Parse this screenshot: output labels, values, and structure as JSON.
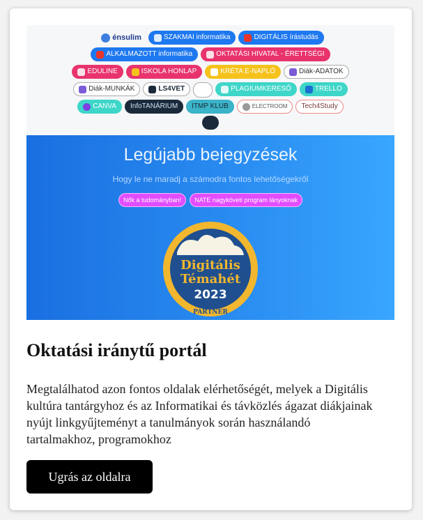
{
  "links_panel": {
    "logo_text": "énsulim",
    "row1": [
      "SZAKMAI informatika",
      "DIGITÁLIS írástudás"
    ],
    "row2": [
      "ALKALMAZOTT informatika",
      "OKTATÁSI HIVATAL - ÉRETTSÉGI"
    ],
    "row3": [
      "EDULINE",
      "ISKOLA HONLAP",
      "KRÉTA E-NAPLÓ",
      "Diák-ADATOK"
    ],
    "row4": [
      "Diák-MUNKÁK",
      "LS4VET",
      "",
      "PLAGIUMKERESŐ",
      "TRELLO"
    ],
    "row5": [
      "CANVA",
      "InfoTANÁRIUM",
      "ITMP KLUB",
      "ELECTROOM",
      "Tech4Study"
    ],
    "colors": {
      "blue": "#1e78f0",
      "red": "#e8352b",
      "pink": "#e8336c",
      "yellow": "#f5c21b",
      "teal": "#3ed6c8",
      "dark": "#1b2a3a"
    }
  },
  "hero": {
    "title": "Legújabb bejegyzések",
    "subtitle": "Hogy le ne maradj a számodra fontos lehetőségekről",
    "tags": [
      "Nők a tudományban!",
      "NATE nagyköveti program lányoknak"
    ],
    "badge": {
      "line1": "Digitális",
      "line2": "Témahét",
      "line3": "2023",
      "ribbon": "PARTNER"
    }
  },
  "card": {
    "title": "Oktatási iránytű portál",
    "description": "Megtalálhatod azon fontos oldalak elérhetőségét, melyek a Digitális kultúra tantárgyhoz és az Informatikai és távközlés ágazat diákjainak nyújt linkgyűjteményt a tanulmányok során használandó tartalmakhoz, programokhoz",
    "button_label": "Ugrás az oldalra"
  }
}
